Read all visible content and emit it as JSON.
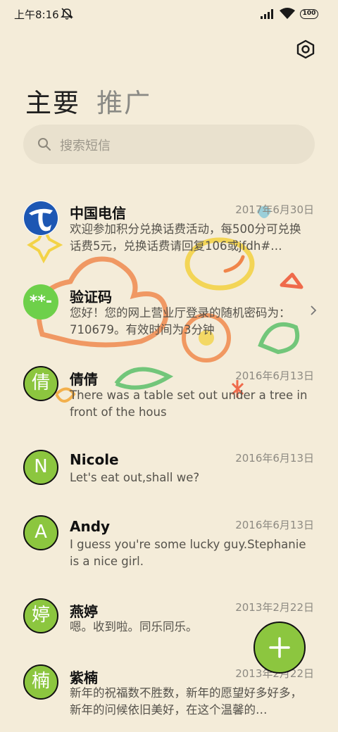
{
  "status": {
    "time": "上午8:16",
    "battery": "100"
  },
  "tabs": {
    "primary": "主要",
    "promo": "推广"
  },
  "search": {
    "placeholder": "搜索短信"
  },
  "conversations": [
    {
      "name": "中国电信",
      "date": "2017年6月30日",
      "preview": "欢迎参加积分兑换话费活动，每500分可兑换话费5元，兑换话费请回复106或jfdh#…",
      "avatar": ""
    },
    {
      "name": "验证码",
      "date": "",
      "preview": "您好！您的网上营业厅登录的随机密码为：710679。有效时间为3分钟",
      "avatar": "**-"
    },
    {
      "name": "倩倩",
      "date": "2016年6月13日",
      "preview": "There was a table set out under a tree in front of the hous",
      "avatar": "倩"
    },
    {
      "name": "Nicole",
      "date": "2016年6月13日",
      "preview": "Let's eat out,shall we?",
      "avatar": "N"
    },
    {
      "name": "Andy",
      "date": "2016年6月13日",
      "preview": "I guess you're some lucky guy.Stephanie is a nice girl.",
      "avatar": "A"
    },
    {
      "name": "燕婷",
      "date": "2013年2月22日",
      "preview": "嗯。收到啦。同乐同乐。",
      "avatar": "婷"
    },
    {
      "name": "紫楠",
      "date": "2013年2月22日",
      "preview": "新年的祝福数不胜数，新年的愿望好多好多，新年的问候依旧美好，在这个温馨的…",
      "avatar": "楠"
    }
  ],
  "colors": {
    "background": "#f4ecd9",
    "avatar_green": "#8cc63f",
    "search_bg": "#e9e1ce"
  },
  "icons": {
    "settings": "settings-icon",
    "search": "search-icon",
    "compose": "plus-icon"
  }
}
